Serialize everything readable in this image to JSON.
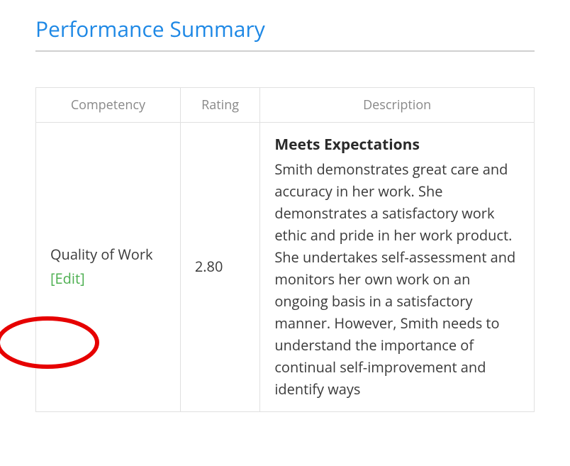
{
  "title": "Performance Summary",
  "columns": {
    "competency": "Competency",
    "rating": "Rating",
    "description": "Description"
  },
  "row": {
    "competency_name": "Quality of Work",
    "edit_label": "[Edit]",
    "rating": "2.80",
    "description_heading": "Meets Expectations",
    "description_text": "Smith demonstrates great care and accuracy in her work. She demonstrates a satisfactory work ethic and pride in her work product. She undertakes self-assessment and monitors her own work on an ongoing basis in a satisfactory manner. However, Smith needs to understand the importance of continual self-improvement and identify ways"
  }
}
